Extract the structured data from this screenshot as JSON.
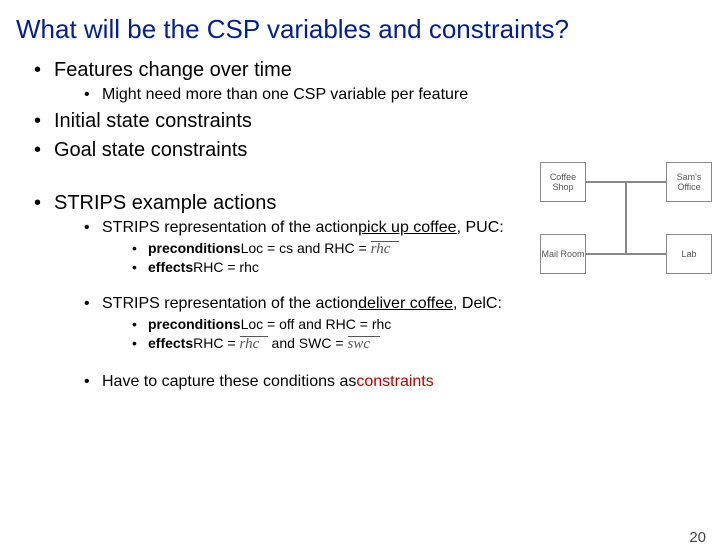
{
  "title": "What will be the CSP variables and constraints?",
  "bullets": {
    "features": "Features change over time",
    "features_sub": "Might need more than one CSP variable per feature",
    "initial": "Initial state constraints",
    "goal": "Goal state constraints",
    "strips": "STRIPS example actions",
    "puc_intro_1": "STRIPS representation of the action ",
    "puc_action": "pick up coffee",
    "puc_intro_2": ", PUC:",
    "puc_pre_label": "preconditions",
    "puc_pre_text": " Loc = cs and RHC = ",
    "puc_pre_math": "rhc",
    "puc_eff_label": "effects",
    "puc_eff_text": " RHC = rhc",
    "delc_intro_1": "STRIPS representation of the action ",
    "delc_action": "deliver coffee",
    "delc_intro_2": ", DelC:",
    "delc_pre_label": "preconditions",
    "delc_pre_text": " Loc = off and RHC = rhc",
    "delc_eff_label": "effects",
    "delc_eff_text1": " RHC = ",
    "delc_eff_math1": "rhc",
    "delc_eff_text2": "  and SWC = ",
    "delc_eff_math2": "swc",
    "capture1": "Have to capture these conditions as ",
    "capture2": "constraints"
  },
  "map": {
    "coffee": "Coffee\nShop",
    "sam": "Sam's\nOffice",
    "mail": "Mail\nRoom",
    "lab": "Lab"
  },
  "page": "20"
}
